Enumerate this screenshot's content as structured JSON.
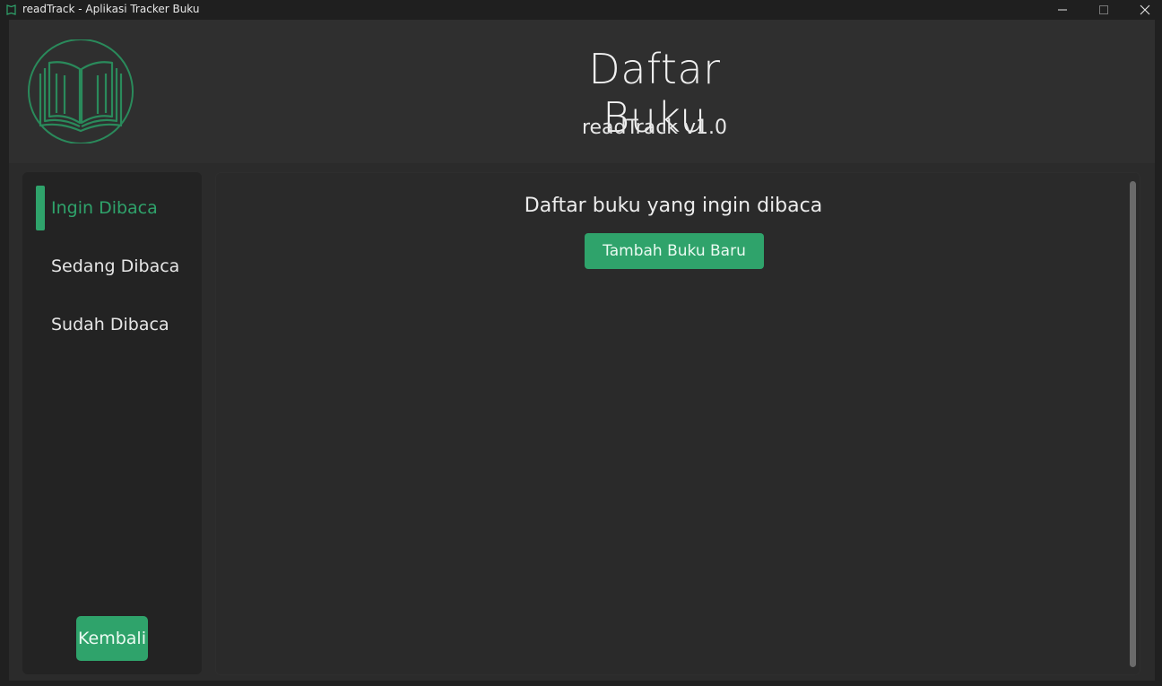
{
  "window": {
    "title": "readTrack - Aplikasi Tracker Buku"
  },
  "header": {
    "title": "Daftar Buku",
    "version": "readTrack v1.0",
    "logo_icon": "open-book-icon"
  },
  "sidebar": {
    "items": [
      {
        "label": "Ingin Dibaca",
        "active": true
      },
      {
        "label": "Sedang Dibaca",
        "active": false
      },
      {
        "label": "Sudah Dibaca",
        "active": false
      }
    ],
    "back_label": "Kembali"
  },
  "main": {
    "title": "Daftar buku yang ingin dibaca",
    "add_button_label": "Tambah Buku Baru"
  },
  "colors": {
    "accent": "#2fa36b",
    "background": "#2b2b2b",
    "panel": "#232323",
    "text": "#e6e6e6"
  }
}
